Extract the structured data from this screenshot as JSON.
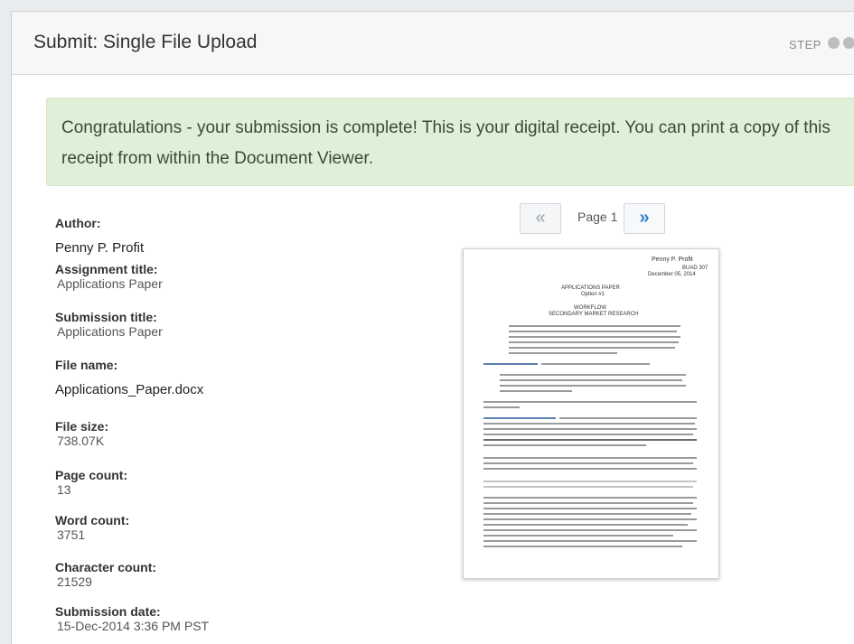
{
  "header": {
    "title": "Submit: Single File Upload",
    "step_label": "STEP"
  },
  "banner": {
    "message": "Congratulations - your submission is complete! This is your digital receipt. You can print a copy of this receipt from within the Document Viewer."
  },
  "meta": {
    "author_label": "Author:",
    "author_value": "Penny P. Profit",
    "assignment_label": "Assignment title:",
    "assignment_value": "Applications Paper",
    "submission_label": "Submission title:",
    "submission_value": "Applications Paper",
    "filename_label": "File name:",
    "filename_value": "Applications_Paper.docx",
    "filesize_label": "File size:",
    "filesize_value": "738.07K",
    "pagecount_label": "Page count:",
    "pagecount_value": "13",
    "wordcount_label": "Word count:",
    "wordcount_value": "3751",
    "charcount_label": "Character count:",
    "charcount_value": "21529",
    "date_label": "Submission date:",
    "date_value": "15-Dec-2014 3:36 PM PST"
  },
  "viewer": {
    "prev_icon": "«",
    "next_icon": "»",
    "page_label": "Page 1",
    "doc_author": "Penny P. Profit",
    "doc_course": "BUAD 307",
    "doc_date": "December 05, 2014",
    "doc_title": "APPLICATIONS PAPER",
    "doc_option": "Option #1",
    "doc_workflow": "WORKFLOW",
    "doc_subtitle": "SECONDARY MARKET RESEARCH"
  },
  "colors": {
    "banner_bg": "#dfefd8",
    "header_bg": "#f7f7f7",
    "next_button": "#2f80c8"
  }
}
